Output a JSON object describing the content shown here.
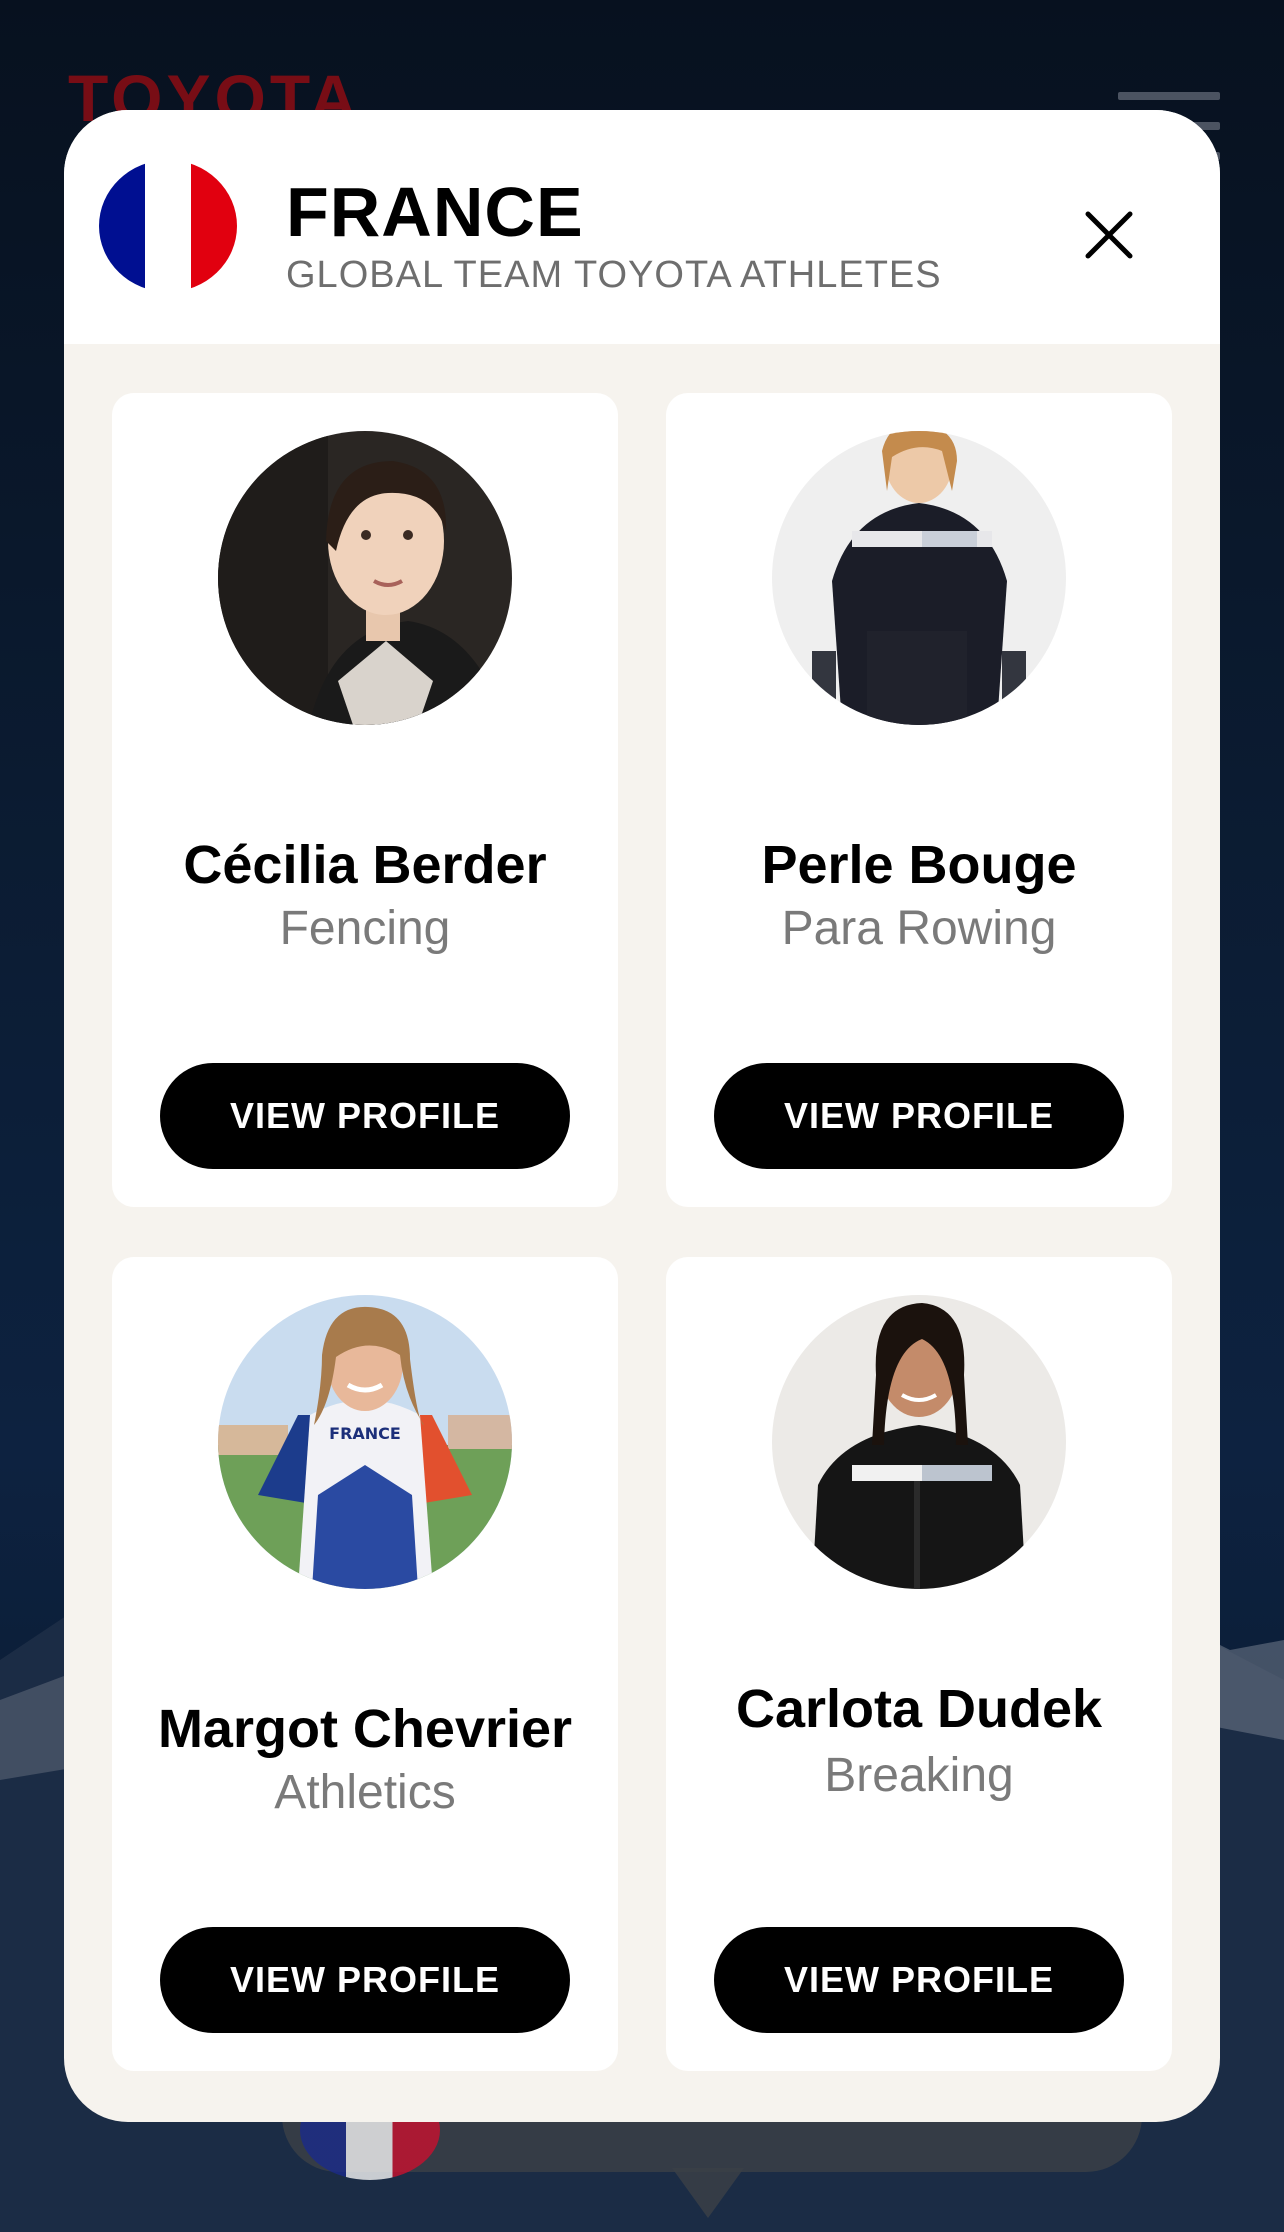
{
  "background": {
    "brand_logo": "TOYOTA"
  },
  "modal": {
    "country": "FRANCE",
    "subtitle": "GLOBAL TEAM TOYOTA ATHLETES",
    "flag_icon": "france-flag-icon",
    "close_icon": "close-icon"
  },
  "athletes": [
    {
      "name": "Cécilia Berder",
      "sport": "Fencing",
      "button": "VIEW PROFILE"
    },
    {
      "name": "Perle Bouge",
      "sport": "Para Rowing",
      "button": "VIEW PROFILE"
    },
    {
      "name": "Margot Chevrier",
      "sport": "Athletics",
      "button": "VIEW PROFILE"
    },
    {
      "name": "Carlota Dudek",
      "sport": "Breaking",
      "button": "VIEW PROFILE"
    }
  ],
  "colors": {
    "modal_bg": "#f6f3ee",
    "button_bg": "#000000",
    "flag_blue": "#000f91",
    "flag_red": "#e1000f"
  }
}
